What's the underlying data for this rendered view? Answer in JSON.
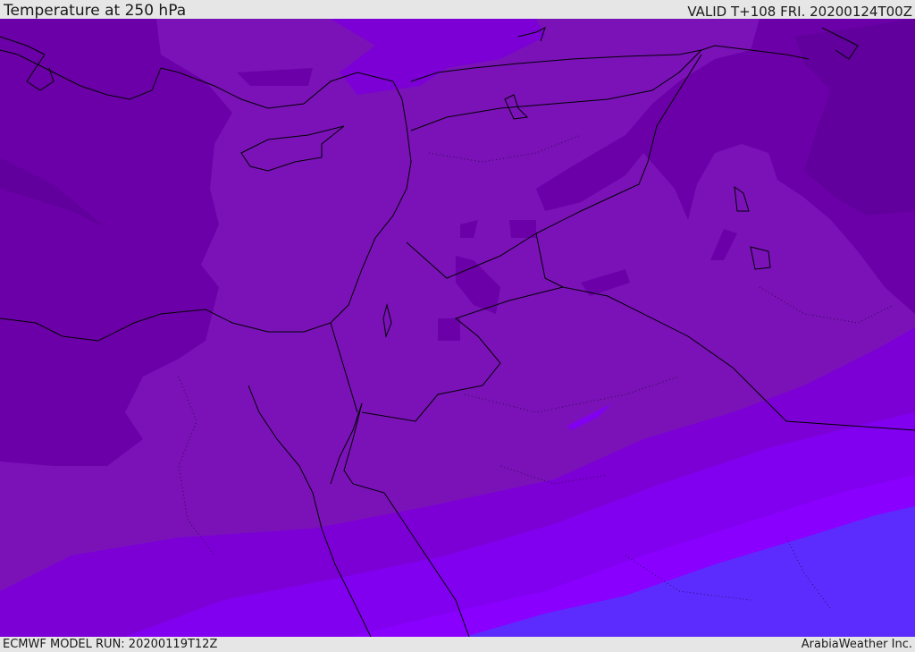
{
  "header": {
    "title": "Temperature at 250 hPa",
    "valid": "VALID T+108 FRI. 20200124T00Z"
  },
  "footer": {
    "model_run": "ECMWF MODEL RUN: 20200119T12Z",
    "credit": "ArabiaWeather Inc."
  },
  "map": {
    "field": "temperature",
    "level": "250 hPa",
    "colors": {
      "coldest": "#5e009a",
      "cold": "#6c00a8",
      "mid": "#7a12b8",
      "warm1": "#7c00d6",
      "warm2": "#8200f0",
      "warm3": "#8a00ff",
      "warmest": "#5c2cff",
      "coastline": "#000000",
      "border": "#000000"
    }
  }
}
